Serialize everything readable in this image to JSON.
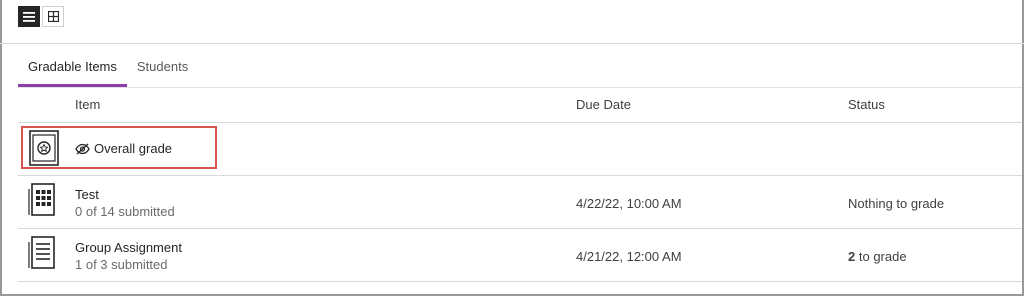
{
  "toolbar": {
    "list_view_icon": "list-icon",
    "grid_view_icon": "grid-icon"
  },
  "tabs": [
    {
      "label": "Gradable Items",
      "active": true
    },
    {
      "label": "Students",
      "active": false
    }
  ],
  "table": {
    "headers": {
      "item": "Item",
      "due_date": "Due Date",
      "status": "Status"
    },
    "overall": {
      "label": "Overall grade",
      "icon": "eye-slash-icon",
      "row_icon": "overall-grade-icon"
    },
    "rows": [
      {
        "title": "Test",
        "subtitle": "0 of 14 submitted",
        "due_date": "4/22/22, 10:00 AM",
        "status": "Nothing to grade",
        "status_count": "",
        "icon": "test-icon"
      },
      {
        "title": "Group Assignment",
        "subtitle": "1 of 3 submitted",
        "due_date": "4/21/22, 12:00 AM",
        "status": "to grade",
        "status_count": "2",
        "icon": "assignment-icon"
      }
    ]
  },
  "colors": {
    "accent": "#8d3ea8",
    "highlight": "#d9534f"
  }
}
